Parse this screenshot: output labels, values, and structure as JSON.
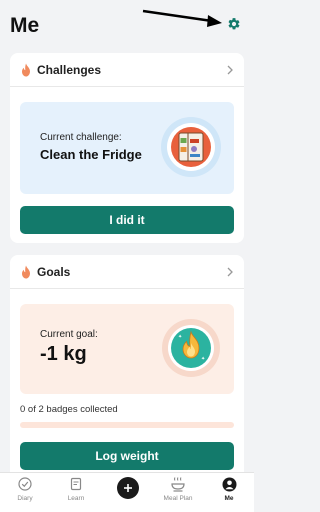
{
  "header": {
    "title": "Me",
    "settings_icon": "gear-icon"
  },
  "colors": {
    "primary": "#137a6b",
    "accent_orange": "#f08a5d",
    "challenge_bg": "#e5f1fc",
    "goal_bg": "#fdeee6"
  },
  "challenges": {
    "title": "Challenges",
    "current_label": "Current challenge:",
    "current_value": "Clean the Fridge",
    "button_label": "I did it",
    "icon": "fridge-icon"
  },
  "goals": {
    "title": "Goals",
    "current_label": "Current goal:",
    "current_value": "-1 kg",
    "badges_text": "0 of 2 badges collected",
    "badges_collected": 0,
    "badges_total": 2,
    "button_label": "Log weight",
    "icon": "flame-badge-icon"
  },
  "nav": {
    "items": [
      {
        "label": "Diary",
        "icon": "diary-check-icon",
        "active": false
      },
      {
        "label": "Learn",
        "icon": "learn-book-icon",
        "active": false
      },
      {
        "label": "",
        "icon": "add-icon",
        "active": false
      },
      {
        "label": "Meal Plan",
        "icon": "meal-plan-icon",
        "active": false
      },
      {
        "label": "Me",
        "icon": "profile-icon",
        "active": true
      }
    ]
  }
}
